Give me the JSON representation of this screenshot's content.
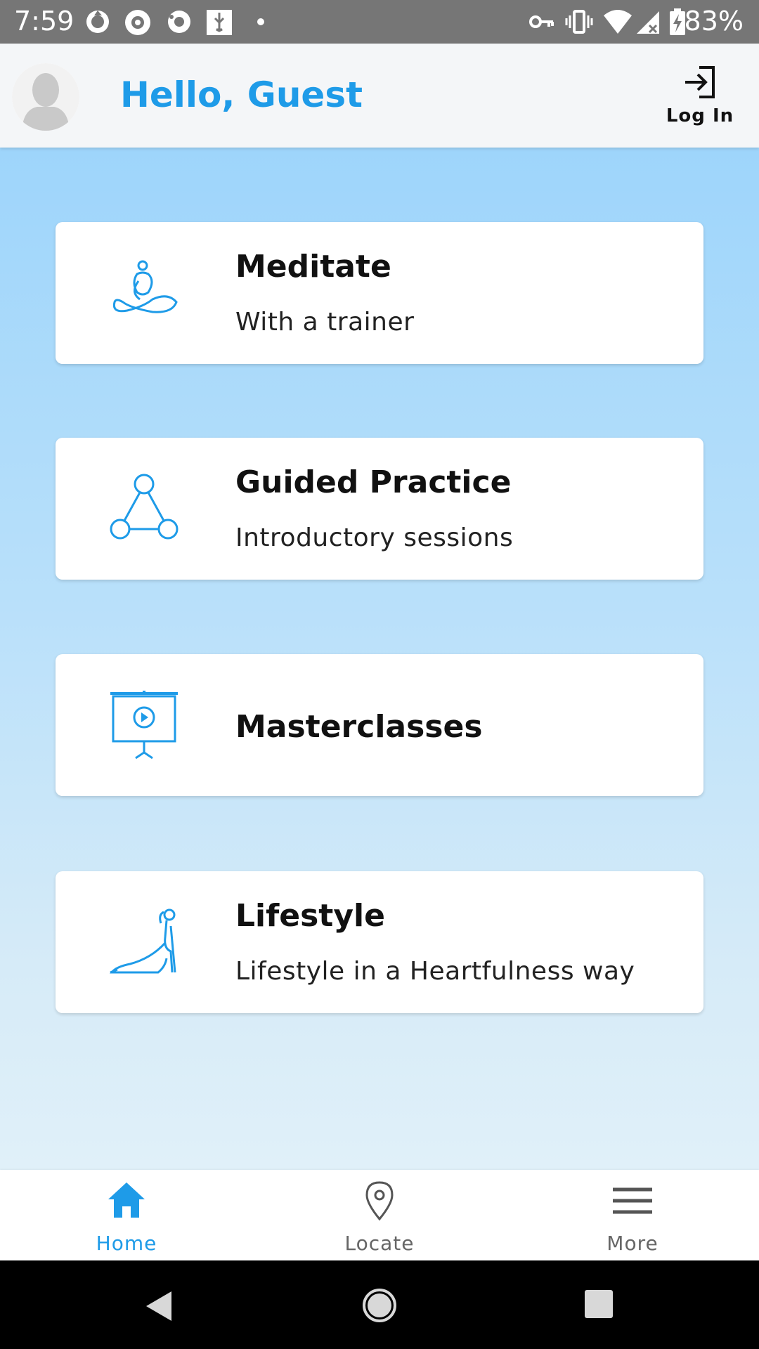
{
  "status_bar": {
    "time": "7:59",
    "battery": "83%",
    "icons": [
      "sync-icon",
      "camera-icon",
      "sync-alt-icon",
      "usb-icon",
      "dot-icon",
      "vpn-key-icon",
      "vibrate-icon",
      "wifi-icon",
      "signal-icon",
      "battery-charging-icon"
    ]
  },
  "header": {
    "greeting": "Hello, Guest",
    "login_label": "Log In"
  },
  "cards": [
    {
      "title": "Meditate",
      "subtitle": "With a trainer",
      "icon": "meditation-icon"
    },
    {
      "title": "Guided Practice",
      "subtitle": "Introductory sessions",
      "icon": "triangle-nodes-icon"
    },
    {
      "title": "Masterclasses",
      "icon": "presentation-screen-icon"
    },
    {
      "title": "Lifestyle",
      "subtitle": "Lifestyle in a Heartfulness way",
      "icon": "yoga-pose-icon"
    }
  ],
  "bottom_nav": {
    "items": [
      {
        "label": "Home",
        "icon": "home-icon",
        "active": true
      },
      {
        "label": "Locate",
        "icon": "location-pin-icon",
        "active": false
      },
      {
        "label": "More",
        "icon": "menu-icon",
        "active": false
      }
    ]
  },
  "colors": {
    "accent": "#1e9be8",
    "inactive": "#666666",
    "header_bg": "#f4f6f8",
    "status_bar": "#767676"
  }
}
